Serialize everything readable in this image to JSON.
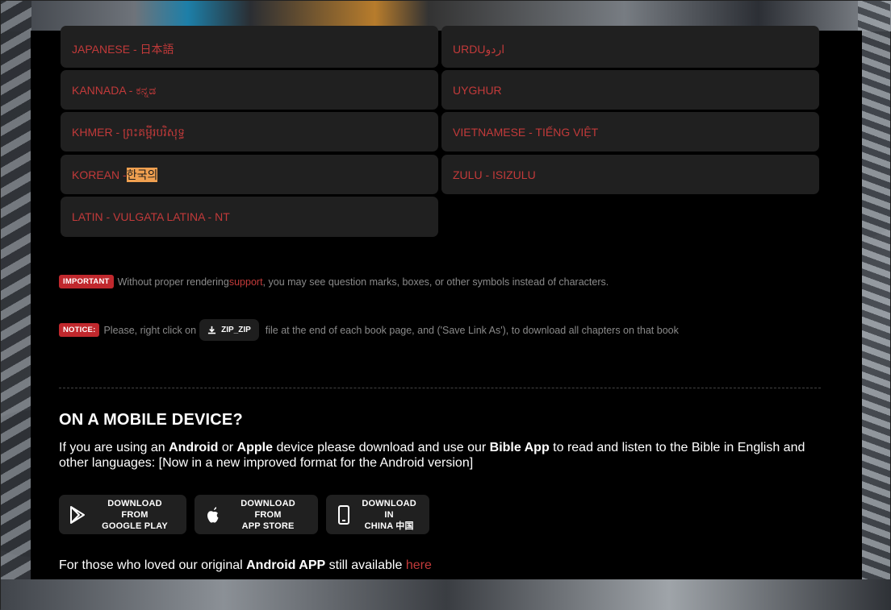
{
  "languages": {
    "left": [
      {
        "label": "JAPANESE - 日本語"
      },
      {
        "label": "KANNADA - ಕನ್ನಡ"
      },
      {
        "label": "KHMER - ព្រះគម្ពីរបរិសុទ្ធ"
      },
      {
        "prefix": "KOREAN - ",
        "highlight": "한국의"
      },
      {
        "label": "LATIN - VULGATA LATINA - NT"
      }
    ],
    "right": [
      {
        "label": "URDUاردو"
      },
      {
        "label": "UYGHUR"
      },
      {
        "label": "VIETNAMESE - TIẾNG VIỆT"
      },
      {
        "label": "ZULU - ISIZULU"
      }
    ]
  },
  "important": {
    "badge": "IMPORTANT",
    "text_before": "Without proper rendering ",
    "link": "support",
    "text_after": ", you may see question marks, boxes, or other symbols instead of characters."
  },
  "notice": {
    "badge": "NOTICE:",
    "text_before": "Please, right click on",
    "zip_label": "ZIP_ZIP",
    "text_after": "file at the end of each book page, and ('Save Link As'), to download all chapters on that book"
  },
  "mobile": {
    "heading": "ON A MOBILE DEVICE?",
    "p1": "If you are using an ",
    "android": "Android",
    "p2": " or ",
    "apple": "Apple",
    "p3": " device please download and use our ",
    "bibleapp": "Bible App",
    "p4": " to read and listen to the Bible in English and other languages: [Now in a new improved format for the Android version]"
  },
  "store_buttons": [
    {
      "line1": "DOWNLOAD FROM",
      "line2": "GOOGLE PLAY",
      "icon": "google-play-icon"
    },
    {
      "line1": "DOWNLOAD FROM",
      "line2": "APP STORE",
      "icon": "apple-icon"
    },
    {
      "line1": "DOWNLOAD IN",
      "line2": "CHINA 中国",
      "icon": "mobile-phone-icon"
    }
  ],
  "footer": {
    "text_before": "For those who loved our original ",
    "bold": "Android APP",
    "text_after": " still available ",
    "link": "here"
  },
  "colors": {
    "accent_red": "#c23a3a",
    "badge_red": "#c0282d",
    "button_bg": "#202020",
    "highlight": "#f0a050"
  }
}
